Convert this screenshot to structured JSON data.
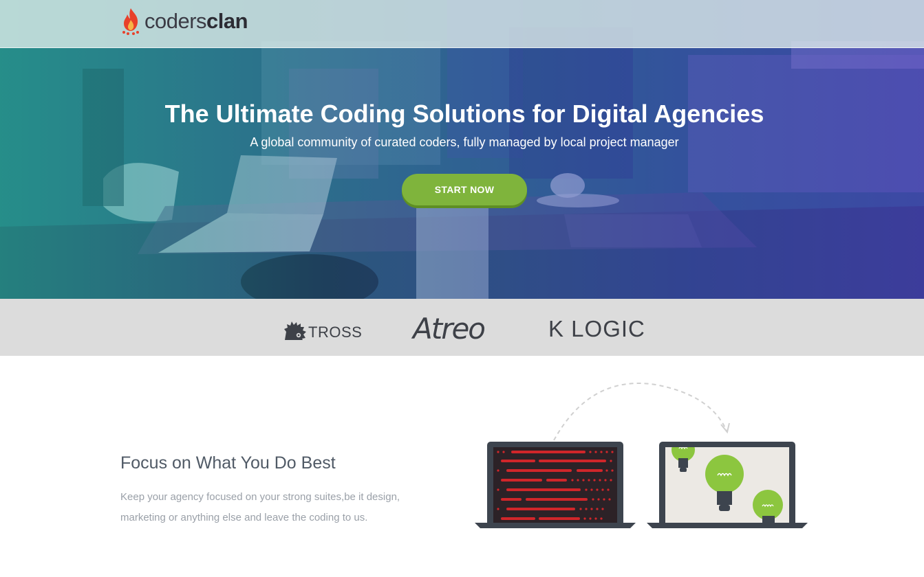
{
  "brand": {
    "name_light": "coders",
    "name_bold": "clan",
    "accent": "#e8402a"
  },
  "hero": {
    "title": "The Ultimate Coding Solutions for Digital Agencies",
    "subtitle": "A global community of curated coders, fully managed by local project manager",
    "cta_label": "START NOW",
    "cta_color": "#7fb43c"
  },
  "clients": [
    {
      "name": "TROSS",
      "icon": "hedgehog-icon"
    },
    {
      "name": "Atreo"
    },
    {
      "name": "K LOGIC"
    }
  ],
  "feature": {
    "title": "Focus on What You Do Best",
    "text": "Keep your agency focused on your strong suites,be it design, marketing or anything else and leave the coding to us."
  },
  "illustration": {
    "left_icon": "code-laptop-icon",
    "right_icon": "lightbulb-laptop-icon",
    "arrow_icon": "curved-arrow-icon"
  }
}
